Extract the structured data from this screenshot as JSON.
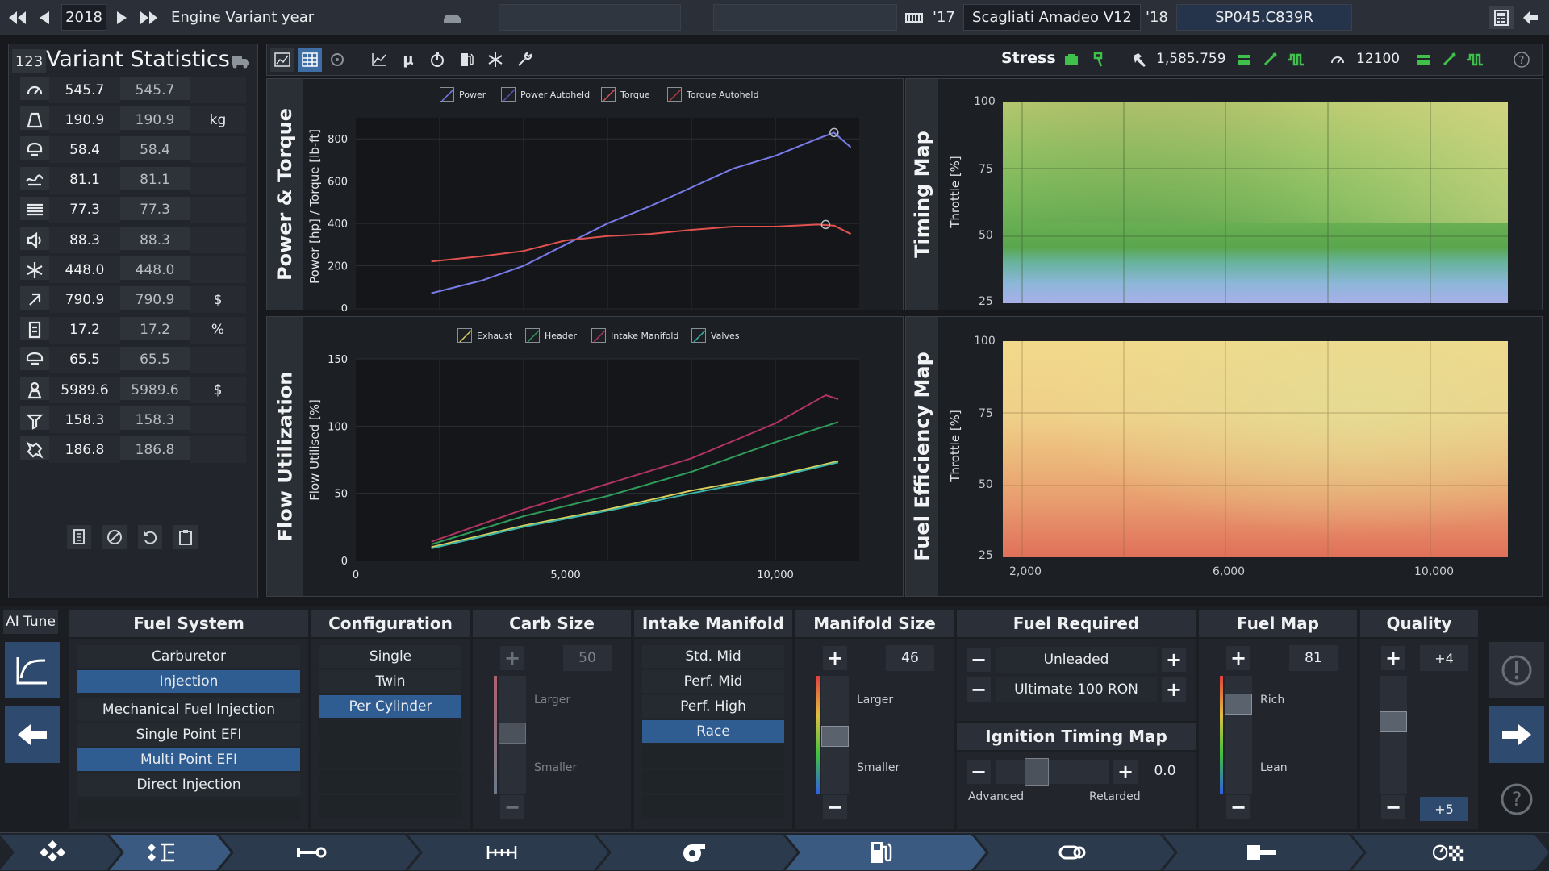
{
  "top": {
    "year": "2018",
    "variant_year_label": "Engine Variant year",
    "year_from": "'17",
    "engine_name": "Scagliati Amadeo V12",
    "year_to": "'18",
    "variant_code": "SP045.C839R"
  },
  "stats": {
    "badge": "123",
    "title": "Variant Statistics",
    "rows": [
      {
        "icon": "power-gauge-icon",
        "v1": "545.7",
        "v2": "545.7",
        "unit": ""
      },
      {
        "icon": "weight-icon",
        "v1": "190.9",
        "v2": "190.9",
        "unit": "kg"
      },
      {
        "icon": "fuel-economy-icon",
        "v1": "58.4",
        "v2": "58.4",
        "unit": ""
      },
      {
        "icon": "smoothness-icon",
        "v1": "81.1",
        "v2": "81.1",
        "unit": ""
      },
      {
        "icon": "emissions-icon",
        "v1": "77.3",
        "v2": "77.3",
        "unit": ""
      },
      {
        "icon": "noise-icon",
        "v1": "88.3",
        "v2": "88.3",
        "unit": ""
      },
      {
        "icon": "cooling-icon",
        "v1": "448.0",
        "v2": "448.0",
        "unit": ""
      },
      {
        "icon": "material-cost-icon",
        "v1": "790.9",
        "v2": "790.9",
        "unit": "$"
      },
      {
        "icon": "efficiency-icon",
        "v1": "17.2",
        "v2": "17.2",
        "unit": "%"
      },
      {
        "icon": "reliability-icon",
        "v1": "65.5",
        "v2": "65.5",
        "unit": ""
      },
      {
        "icon": "engineering-cost-icon",
        "v1": "5989.6",
        "v2": "5989.6",
        "unit": "$"
      },
      {
        "icon": "production-time-icon",
        "v1": "158.3",
        "v2": "158.3",
        "unit": ""
      },
      {
        "icon": "service-cost-icon",
        "v1": "186.8",
        "v2": "186.8",
        "unit": ""
      }
    ]
  },
  "toolbar": {
    "stress_label": "Stress",
    "stress_value": "1,585.759",
    "rpm_value": "12100"
  },
  "power_torque": {
    "title": "Power & Torque",
    "ylabel": "Power [hp] / Torque [lb-ft]",
    "legend": [
      "Power",
      "Power Autoheld",
      "Torque",
      "Torque Autoheld"
    ],
    "yticks": [
      "800",
      "600",
      "400",
      "200",
      "0"
    ]
  },
  "flow": {
    "title": "Flow Utilization",
    "ylabel": "Flow Utilised [%]",
    "legend": [
      "Exhaust",
      "Header",
      "Intake Manifold",
      "Valves"
    ],
    "yticks": [
      "150",
      "100",
      "50",
      "0"
    ],
    "xticks": [
      "0",
      "5,000",
      "10,000"
    ]
  },
  "timing_map": {
    "title": "Timing Map",
    "ylabel": "Throttle [%]",
    "yticks": [
      "100",
      "75",
      "50",
      "25"
    ]
  },
  "fuel_eff_map": {
    "title": "Fuel Efficiency Map",
    "ylabel": "Throttle [%]",
    "yticks": [
      "100",
      "75",
      "50",
      "25"
    ],
    "xticks": [
      "2,000",
      "6,000",
      "10,000"
    ]
  },
  "chart_data": [
    {
      "type": "line",
      "title": "Power & Torque",
      "ylabel": "Power [hp] / Torque [lb-ft]",
      "xlim": [
        0,
        12000
      ],
      "ylim": [
        0,
        900
      ],
      "series": [
        {
          "name": "Power",
          "color": "#7a7bea",
          "x": [
            1800,
            3000,
            4000,
            5000,
            6000,
            7000,
            8000,
            9000,
            10000,
            11000,
            11400,
            11800
          ],
          "y": [
            70,
            130,
            200,
            300,
            400,
            480,
            570,
            660,
            720,
            800,
            830,
            760
          ]
        },
        {
          "name": "Torque",
          "color": "#e0514f",
          "x": [
            1800,
            3000,
            4000,
            5000,
            6000,
            7000,
            8000,
            9000,
            10000,
            11000,
            11400,
            11800
          ],
          "y": [
            220,
            245,
            270,
            320,
            340,
            350,
            370,
            385,
            385,
            395,
            390,
            350
          ]
        }
      ],
      "markers": [
        {
          "series": "Power",
          "x": 11400,
          "y": 830
        },
        {
          "series": "Torque",
          "x": 11200,
          "y": 395
        }
      ]
    },
    {
      "type": "line",
      "title": "Flow Utilization",
      "ylabel": "Flow Utilised [%]",
      "xlim": [
        0,
        12000
      ],
      "ylim": [
        0,
        150
      ],
      "series": [
        {
          "name": "Exhaust",
          "color": "#d6cf5a",
          "x": [
            1800,
            4000,
            6000,
            8000,
            10000,
            11500
          ],
          "y": [
            10,
            26,
            38,
            52,
            63,
            74
          ]
        },
        {
          "name": "Header",
          "color": "#2f9a5a",
          "x": [
            1800,
            4000,
            6000,
            8000,
            10000,
            11500
          ],
          "y": [
            12,
            33,
            48,
            66,
            88,
            103
          ]
        },
        {
          "name": "Intake Manifold",
          "color": "#b0345e",
          "x": [
            1800,
            4000,
            6000,
            8000,
            10000,
            11200,
            11500
          ],
          "y": [
            14,
            38,
            57,
            76,
            102,
            123,
            120
          ]
        },
        {
          "name": "Valves",
          "color": "#3cb3a8",
          "x": [
            1800,
            4000,
            6000,
            8000,
            10000,
            11500
          ],
          "y": [
            9,
            25,
            37,
            50,
            62,
            73
          ]
        }
      ]
    }
  ],
  "bottom": {
    "ai_tune": "AI Tune",
    "fuel_system": {
      "title": "Fuel System",
      "options": [
        "Carburetor",
        "Injection",
        "Mechanical Fuel Injection",
        "Single Point EFI",
        "Multi Point EFI",
        "Direct Injection"
      ]
    },
    "configuration": {
      "title": "Configuration",
      "options": [
        "Single",
        "Twin",
        "Per Cylinder"
      ]
    },
    "carb_size": {
      "title": "Carb Size",
      "value": "50",
      "larger": "Larger",
      "smaller": "Smaller"
    },
    "intake_manifold": {
      "title": "Intake Manifold",
      "options": [
        "Std. Mid",
        "Perf. Mid",
        "Perf. High",
        "Race"
      ]
    },
    "manifold_size": {
      "title": "Manifold Size",
      "value": "46",
      "larger": "Larger",
      "smaller": "Smaller"
    },
    "fuel_required": {
      "title": "Fuel Required",
      "fuel1": "Unleaded",
      "fuel2": "Ultimate 100 RON"
    },
    "ignition": {
      "title": "Ignition Timing Map",
      "value": "0.0",
      "advanced": "Advanced",
      "retarded": "Retarded"
    },
    "fuel_map": {
      "title": "Fuel Map",
      "value": "81",
      "rich": "Rich",
      "lean": "Lean"
    },
    "quality": {
      "title": "Quality",
      "top": "+4",
      "bottom": "+5"
    }
  }
}
